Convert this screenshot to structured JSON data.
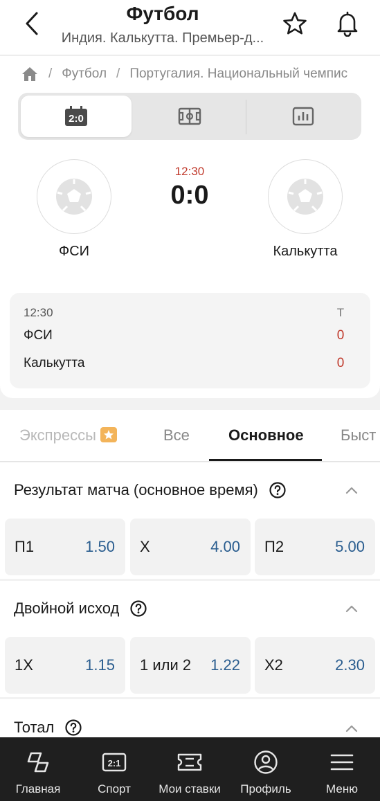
{
  "header": {
    "title": "Футбол",
    "subtitle": "Индия. Калькутта. Премьер-д..."
  },
  "breadcrumb": {
    "items": [
      "Футбол",
      "Португалия. Национальный чемпис"
    ]
  },
  "match": {
    "time": "12:30",
    "score": "0:0",
    "home_team": "ФСИ",
    "away_team": "Калькутта"
  },
  "score_table": {
    "time": "12:30",
    "column": "Т",
    "rows": [
      {
        "team": "ФСИ",
        "value": "0"
      },
      {
        "team": "Калькутта",
        "value": "0"
      }
    ]
  },
  "market_tabs": [
    {
      "label": "Экспрессы"
    },
    {
      "label": "Все"
    },
    {
      "label": "Основное"
    },
    {
      "label": "Быст"
    }
  ],
  "markets": [
    {
      "title": "Результат матча (основное время)",
      "odds": [
        {
          "label": "П1",
          "value": "1.50"
        },
        {
          "label": "X",
          "value": "4.00"
        },
        {
          "label": "П2",
          "value": "5.00"
        }
      ]
    },
    {
      "title": "Двойной исход",
      "odds": [
        {
          "label": "1X",
          "value": "1.15"
        },
        {
          "label": "1 или 2",
          "value": "1.22"
        },
        {
          "label": "X2",
          "value": "2.30"
        }
      ]
    },
    {
      "title": "Тотал"
    }
  ],
  "bottom_nav": [
    {
      "label": "Главная",
      "icon": "home-nav-icon"
    },
    {
      "label": "Спорт",
      "icon": "sport-score-icon"
    },
    {
      "label": "Мои ставки",
      "icon": "ticket-icon"
    },
    {
      "label": "Профиль",
      "icon": "profile-icon"
    },
    {
      "label": "Меню",
      "icon": "menu-icon"
    }
  ],
  "colors": {
    "accent_red": "#c0392b",
    "odds_blue": "#2a5d8f",
    "nav_bg": "#1f1f1f"
  }
}
